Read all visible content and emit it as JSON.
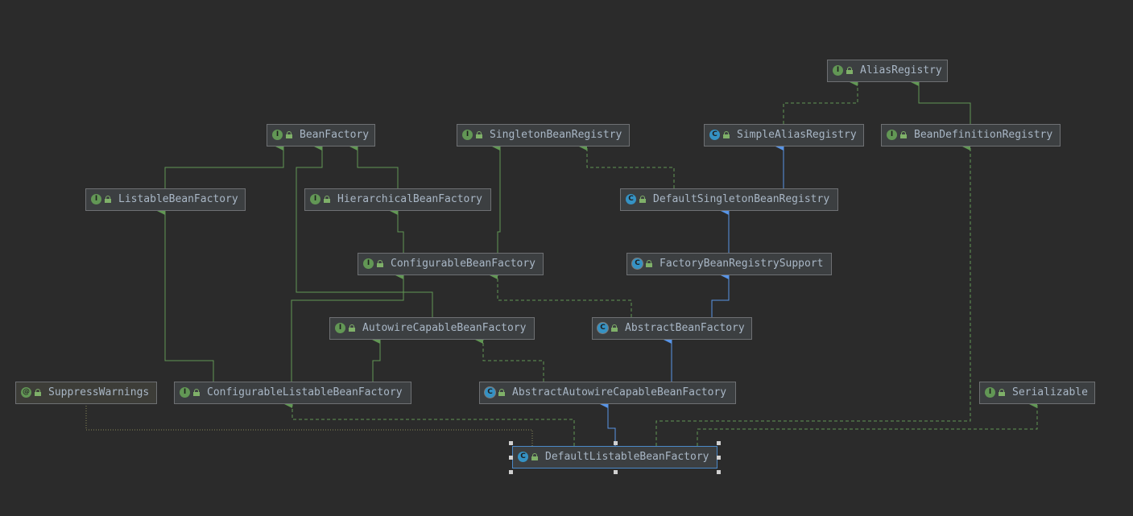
{
  "diagram": {
    "nodes": [
      {
        "id": "AliasRegistry",
        "label": "AliasRegistry",
        "kind": "interface"
      },
      {
        "id": "BeanFactory",
        "label": "BeanFactory",
        "kind": "interface"
      },
      {
        "id": "SingletonBeanRegistry",
        "label": "SingletonBeanRegistry",
        "kind": "interface"
      },
      {
        "id": "SimpleAliasRegistry",
        "label": "SimpleAliasRegistry",
        "kind": "class"
      },
      {
        "id": "BeanDefinitionRegistry",
        "label": "BeanDefinitionRegistry",
        "kind": "interface"
      },
      {
        "id": "ListableBeanFactory",
        "label": "ListableBeanFactory",
        "kind": "interface"
      },
      {
        "id": "HierarchicalBeanFactory",
        "label": "HierarchicalBeanFactory",
        "kind": "interface"
      },
      {
        "id": "DefaultSingletonBeanRegistry",
        "label": "DefaultSingletonBeanRegistry",
        "kind": "class"
      },
      {
        "id": "ConfigurableBeanFactory",
        "label": "ConfigurableBeanFactory",
        "kind": "interface"
      },
      {
        "id": "FactoryBeanRegistrySupport",
        "label": "FactoryBeanRegistrySupport",
        "kind": "abstract-class"
      },
      {
        "id": "AutowireCapableBeanFactory",
        "label": "AutowireCapableBeanFactory",
        "kind": "interface"
      },
      {
        "id": "AbstractBeanFactory",
        "label": "AbstractBeanFactory",
        "kind": "abstract-class"
      },
      {
        "id": "SuppressWarnings",
        "label": "SuppressWarnings",
        "kind": "annotation-type"
      },
      {
        "id": "ConfigurableListableBeanFactory",
        "label": "ConfigurableListableBeanFactory",
        "kind": "interface"
      },
      {
        "id": "AbstractAutowireCapableBeanFactory",
        "label": "AbstractAutowireCapableBeanFactory",
        "kind": "abstract-class"
      },
      {
        "id": "Serializable",
        "label": "Serializable",
        "kind": "interface"
      },
      {
        "id": "DefaultListableBeanFactory",
        "label": "DefaultListableBeanFactory",
        "kind": "class",
        "selected": true
      }
    ],
    "edges": [
      {
        "from": "SimpleAliasRegistry",
        "to": "AliasRegistry",
        "type": "implements"
      },
      {
        "from": "BeanDefinitionRegistry",
        "to": "AliasRegistry",
        "type": "extends-interface"
      },
      {
        "from": "ListableBeanFactory",
        "to": "BeanFactory",
        "type": "extends-interface"
      },
      {
        "from": "HierarchicalBeanFactory",
        "to": "BeanFactory",
        "type": "extends-interface"
      },
      {
        "from": "AutowireCapableBeanFactory",
        "to": "BeanFactory",
        "type": "extends-interface"
      },
      {
        "from": "DefaultSingletonBeanRegistry",
        "to": "SingletonBeanRegistry",
        "type": "implements"
      },
      {
        "from": "DefaultSingletonBeanRegistry",
        "to": "SimpleAliasRegistry",
        "type": "extends"
      },
      {
        "from": "ConfigurableBeanFactory",
        "to": "HierarchicalBeanFactory",
        "type": "extends-interface"
      },
      {
        "from": "ConfigurableBeanFactory",
        "to": "SingletonBeanRegistry",
        "type": "extends-interface"
      },
      {
        "from": "FactoryBeanRegistrySupport",
        "to": "DefaultSingletonBeanRegistry",
        "type": "extends"
      },
      {
        "from": "AbstractBeanFactory",
        "to": "FactoryBeanRegistrySupport",
        "type": "extends"
      },
      {
        "from": "AbstractBeanFactory",
        "to": "ConfigurableBeanFactory",
        "type": "implements"
      },
      {
        "from": "ConfigurableListableBeanFactory",
        "to": "ListableBeanFactory",
        "type": "extends-interface"
      },
      {
        "from": "ConfigurableListableBeanFactory",
        "to": "AutowireCapableBeanFactory",
        "type": "extends-interface"
      },
      {
        "from": "ConfigurableListableBeanFactory",
        "to": "ConfigurableBeanFactory",
        "type": "extends-interface"
      },
      {
        "from": "AbstractAutowireCapableBeanFactory",
        "to": "AbstractBeanFactory",
        "type": "extends"
      },
      {
        "from": "AbstractAutowireCapableBeanFactory",
        "to": "AutowireCapableBeanFactory",
        "type": "implements"
      },
      {
        "from": "DefaultListableBeanFactory",
        "to": "AbstractAutowireCapableBeanFactory",
        "type": "extends"
      },
      {
        "from": "DefaultListableBeanFactory",
        "to": "ConfigurableListableBeanFactory",
        "type": "implements"
      },
      {
        "from": "DefaultListableBeanFactory",
        "to": "BeanDefinitionRegistry",
        "type": "implements"
      },
      {
        "from": "DefaultListableBeanFactory",
        "to": "Serializable",
        "type": "implements"
      },
      {
        "from": "DefaultListableBeanFactory",
        "to": "SuppressWarnings",
        "type": "annotated-by"
      }
    ]
  },
  "colors": {
    "background": "#2b2b2b",
    "interface_edge": "#629755",
    "class_edge": "#5894e6",
    "annotation_edge": "#8a8a5a",
    "selection": "#4a88c7"
  },
  "badges": {
    "interface": "I",
    "class": "C",
    "abstract-class": "C",
    "annotation-type": "@"
  }
}
